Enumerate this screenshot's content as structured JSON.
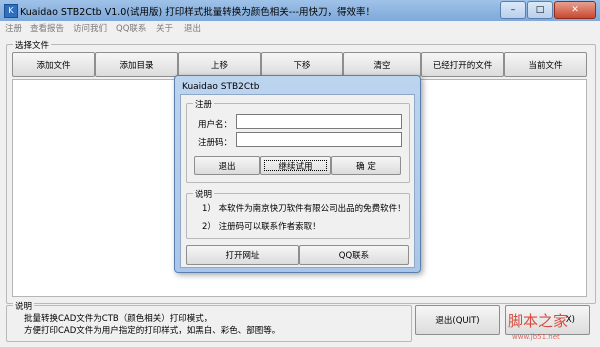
{
  "window": {
    "title": "Kuaidao STB2Ctb  V1.0(试用版) 打印样式批量转换为颜色相关---用快刀，得效率！",
    "minimize": "–",
    "maximize": "□",
    "close": "✕"
  },
  "menu": [
    "注册",
    "查看报告",
    "访问我们",
    "QQ联系",
    "关于",
    "退出"
  ],
  "files_group": {
    "caption": "选择文件",
    "buttons": [
      "添加文件",
      "添加目录",
      "上移",
      "下移",
      "清空",
      "已经打开的文件",
      "当前文件"
    ]
  },
  "dialog": {
    "title": "Kuaidao STB2Ctb",
    "register_group": {
      "caption": "注册",
      "username_label": "用户名：",
      "username_value": "",
      "code_label": "注册码：",
      "code_value": ""
    },
    "buttons": {
      "exit": "退出",
      "continue": "继续试用",
      "ok": "确  定"
    },
    "info_group": {
      "caption": "说明",
      "line1": "1） 本软件为南京快刀软件有限公司出品的免费软件！",
      "line2": "2） 注册码可以联系作者索取！"
    },
    "bottom_buttons": {
      "website": "打开网址",
      "qq": "QQ联系"
    }
  },
  "note_group": {
    "caption": "说明",
    "line1": "批量转换CAD文件为CTB（颜色相关）打印模式，",
    "line2": "方便打印CAD文件为用户指定的打印样式，如黑白、彩色、部图等。"
  },
  "bottom": {
    "exit_button": "退出(QUIT)",
    "partial_button": "X)"
  },
  "watermark": {
    "text": "脚本之家",
    "sub": "www.jb51.net"
  }
}
